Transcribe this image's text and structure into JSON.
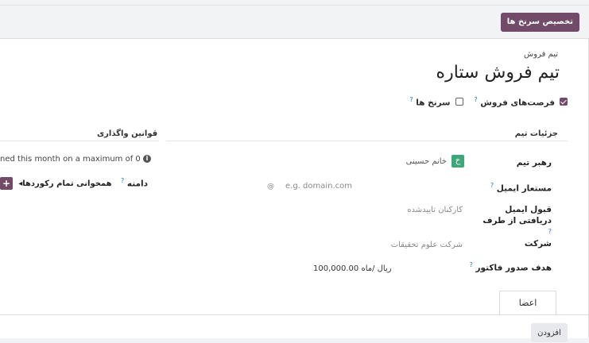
{
  "header": {
    "assign_button": "تخصیص سرنخ ها"
  },
  "form": {
    "name_label": "تیم فروش",
    "team_name": "تیم فروش ستاره",
    "opportunities_label": "فرصت‌های فروش",
    "opportunities_checked": true,
    "leads_label": "سرنخ ها",
    "leads_checked": false,
    "help_mark": "?"
  },
  "team_details": {
    "title": "جزئیات تیم",
    "leader_label": "رهبر تیم",
    "leader_value": "خانم حسینی",
    "leader_initial": "خ",
    "email_alias_label": "مستعار ایمیل",
    "email_alias_placeholder": "e.g. domain.com",
    "accept_emails_label": "قبول ایمیل دریافتی از طرف",
    "accept_emails_value": "کارکنان تاییدشده",
    "company_label": "شرکت",
    "company_value": "شرکت علوم تحقیقات",
    "invoice_target_label": "هدف صدور فاکتور",
    "invoice_target_value": "100,000.00",
    "invoice_target_unit": "ریال /ماه"
  },
  "assignment_rules": {
    "title": "قوانین واگذاری",
    "info_text": "ned this month on a maximum of 0",
    "domain_label": "دامنه",
    "domain_value": "همخوانی تمام رکوردها"
  },
  "tabs": {
    "members_tab": "اعضا"
  },
  "members": {
    "add_button": "افزودن"
  }
}
